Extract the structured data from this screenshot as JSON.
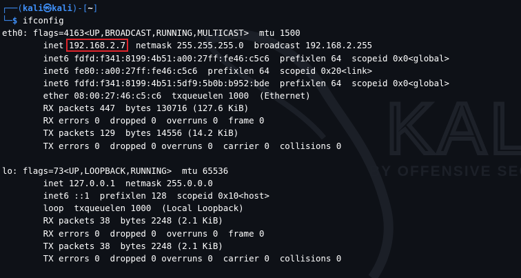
{
  "prompt": {
    "frame_top": "┌──(",
    "user": "kali",
    "at_icon": "㉿",
    "host": "kali",
    "sep": ")-[",
    "path": "~",
    "close": "]",
    "frame_bottom": "└─",
    "dollar": "$",
    "command": "ifconfig"
  },
  "eth0": {
    "header": "eth0: flags=4163<UP,BROADCAST,RUNNING,MULTICAST>  mtu 1500",
    "inet_prefix": "        inet ",
    "inet_addr": "192.168.2.7",
    "inet_rest": "  netmask 255.255.255.0  broadcast 192.168.2.255",
    "inet6_1": "        inet6 fdfd:f341:8199:4b51:a00:27ff:fe46:c5c6  prefixlen 64  scopeid 0x0<global>",
    "inet6_2": "        inet6 fe80::a00:27ff:fe46:c5c6  prefixlen 64  scopeid 0x20<link>",
    "inet6_3": "        inet6 fdfd:f341:8199:4b51:5df9:5b0b:b952:bde  prefixlen 64  scopeid 0x0<global>",
    "ether": "        ether 08:00:27:46:c5:c6  txqueuelen 1000  (Ethernet)",
    "rx_packets": "        RX packets 447  bytes 130716 (127.6 KiB)",
    "rx_errors": "        RX errors 0  dropped 0  overruns 0  frame 0",
    "tx_packets": "        TX packets 129  bytes 14556 (14.2 KiB)",
    "tx_errors": "        TX errors 0  dropped 0 overruns 0  carrier 0  collisions 0"
  },
  "lo": {
    "header": "lo: flags=73<UP,LOOPBACK,RUNNING>  mtu 65536",
    "inet": "        inet 127.0.0.1  netmask 255.0.0.0",
    "inet6": "        inet6 ::1  prefixlen 128  scopeid 0x10<host>",
    "loop": "        loop  txqueuelen 1000  (Local Loopback)",
    "rx_packets": "        RX packets 38  bytes 2248 (2.1 KiB)",
    "rx_errors": "        RX errors 0  dropped 0  overruns 0  frame 0",
    "tx_packets": "        TX packets 38  bytes 2248 (2.1 KiB)",
    "tx_errors": "        TX errors 0  dropped 0 overruns 0  carrier 0  collisions 0"
  },
  "watermark": {
    "brand": "KALI",
    "tagline": "BY OFFENSIVE SEC"
  },
  "colors": {
    "background": "#0e1117",
    "prompt_blue": "#3f8ff7",
    "text": "#ffffff",
    "highlight_box": "#e0242b"
  }
}
